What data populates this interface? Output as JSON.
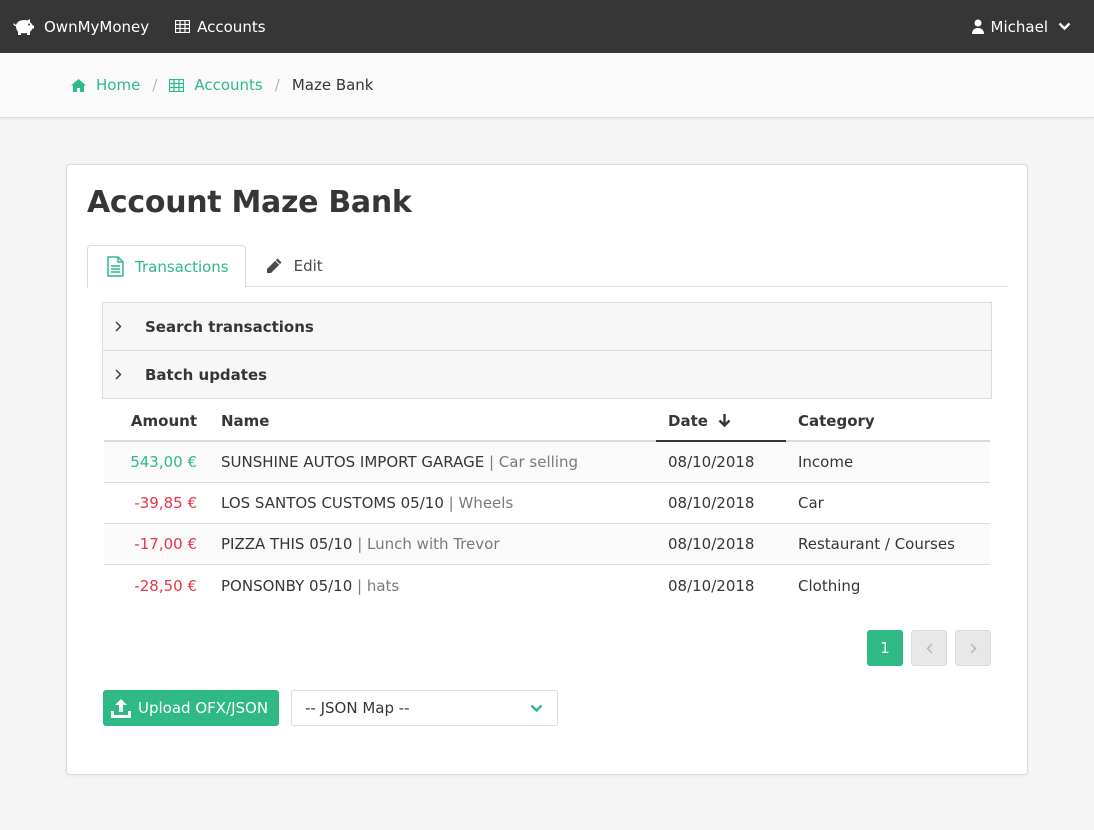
{
  "navbar": {
    "brand": "OwnMyMoney",
    "accounts_link": "Accounts",
    "user_name": "Michael"
  },
  "breadcrumb": {
    "home": "Home",
    "accounts": "Accounts",
    "current": "Maze Bank"
  },
  "page": {
    "title": "Account Maze Bank"
  },
  "tabs": [
    {
      "label": "Transactions",
      "active": true,
      "icon": "file-text-icon"
    },
    {
      "label": "Edit",
      "active": false,
      "icon": "pencil-icon"
    }
  ],
  "panels": {
    "search": "Search transactions",
    "batch": "Batch updates"
  },
  "table": {
    "headers": {
      "amount": "Amount",
      "name": "Name",
      "date": "Date",
      "category": "Category"
    },
    "sort": {
      "column": "date",
      "direction": "descending"
    },
    "rows": [
      {
        "amount": "543,00 €",
        "type": "positive",
        "name": "SUNSHINE AUTOS IMPORT GARAGE",
        "note": "| Car selling",
        "date": "08/10/2018",
        "category": "Income"
      },
      {
        "amount": "-39,85 €",
        "type": "negative",
        "name": "LOS SANTOS CUSTOMS 05/10",
        "note": "| Wheels",
        "date": "08/10/2018",
        "category": "Car"
      },
      {
        "amount": "-17,00 €",
        "type": "negative",
        "name": "PIZZA THIS 05/10",
        "note": "| Lunch with Trevor",
        "date": "08/10/2018",
        "category": "Restaurant / Courses"
      },
      {
        "amount": "-28,50 €",
        "type": "negative",
        "name": "PONSONBY 05/10",
        "note": "| hats",
        "date": "08/10/2018",
        "category": "Clothing"
      }
    ]
  },
  "pagination": {
    "current_page": "1"
  },
  "actions": {
    "upload_label": "Upload OFX/JSON",
    "json_map_selected": "-- JSON Map --"
  },
  "colors": {
    "accent": "#2fb985",
    "negative": "#e5344c",
    "navbar": "#363636"
  }
}
